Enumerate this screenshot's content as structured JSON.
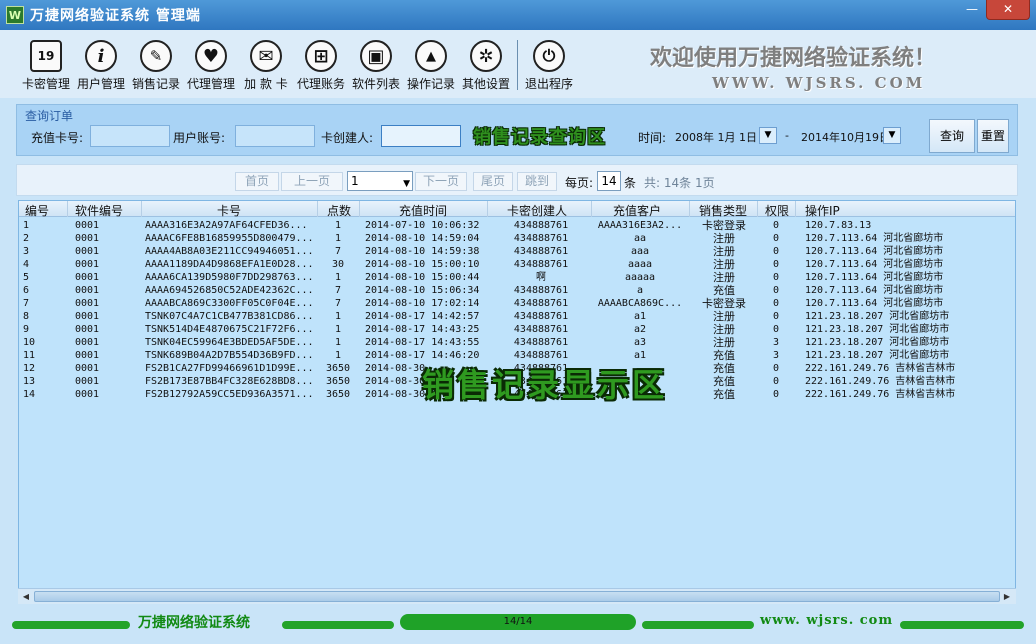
{
  "window": {
    "title": "万捷网络验证系统 管理端",
    "logo": "W",
    "minimize": "—",
    "close": "✕"
  },
  "toolbar": {
    "items": [
      {
        "label": "卡密管理",
        "icon": "calendar-icon",
        "glyph": "19"
      },
      {
        "label": "用户管理",
        "icon": "info-icon",
        "glyph": "i"
      },
      {
        "label": "销售记录",
        "icon": "pin-icon",
        "glyph": "✎"
      },
      {
        "label": "代理管理",
        "icon": "heart-icon",
        "glyph": "♥"
      },
      {
        "label": "加 款 卡",
        "icon": "mail-icon",
        "glyph": "✉"
      },
      {
        "label": "代理账务",
        "icon": "windows-icon",
        "glyph": "⊞"
      },
      {
        "label": "软件列表",
        "icon": "save-icon",
        "glyph": "▣"
      },
      {
        "label": "操作记录",
        "icon": "navigation-icon",
        "glyph": "▲"
      },
      {
        "label": "其他设置",
        "icon": "gear-icon",
        "glyph": "✲"
      },
      {
        "label": "退出程序",
        "icon": "power-icon",
        "glyph": "⏻"
      }
    ],
    "welcome": "欢迎使用万捷网络验证系统！",
    "website": "WWW. WJSRS. COM"
  },
  "query": {
    "group_title": "查询订单",
    "card_label": "充值卡号:",
    "card_value": "",
    "user_label": "用户账号:",
    "user_value": "",
    "creator_label": "卡创建人:",
    "creator_value": "",
    "time_label": "时间:",
    "date_from": "2008年  1月  1日",
    "date_sep": "-",
    "date_to": "2014年10月19日",
    "search_button": "查询",
    "reset_button": "重置",
    "overlay": "销售记录查询区"
  },
  "pager": {
    "first": "首页",
    "prev": "上一页",
    "page_select": "1",
    "next": "下一页",
    "last": "尾页",
    "jump": "跳到",
    "per_page_label": "每页:",
    "per_page_value": "14",
    "per_page_unit": "条",
    "summary": "共: 14条 1页"
  },
  "grid": {
    "columns": [
      "编号",
      "软件编号",
      "卡号",
      "点数",
      "充值时间",
      "卡密创建人",
      "充值客户",
      "销售类型",
      "权限",
      "操作IP"
    ],
    "rows": [
      [
        "1",
        "0001",
        "AAAA316E3A2A97AF64CFED36...",
        "1",
        "2014-07-10 10:06:32",
        "434888761",
        "AAAA316E3A2...",
        "卡密登录",
        "0",
        "120.7.83.13"
      ],
      [
        "2",
        "0001",
        "AAAAC6FE8B16859955D800479...",
        "1",
        "2014-08-10 14:59:04",
        "434888761",
        "aa",
        "注册",
        "0",
        "120.7.113.64  河北省廊坊市"
      ],
      [
        "3",
        "0001",
        "AAAA4AB8A03E211CC94946051...",
        "7",
        "2014-08-10 14:59:38",
        "434888761",
        "aaa",
        "注册",
        "0",
        "120.7.113.64  河北省廊坊市"
      ],
      [
        "4",
        "0001",
        "AAAA1189DA4D9868EFA1E0D28...",
        "30",
        "2014-08-10 15:00:10",
        "434888761",
        "aaaa",
        "注册",
        "0",
        "120.7.113.64  河北省廊坊市"
      ],
      [
        "5",
        "0001",
        "AAAA6CA139D5980F7DD298763...",
        "1",
        "2014-08-10 15:00:44",
        "啊",
        "aaaaa",
        "注册",
        "0",
        "120.7.113.64  河北省廊坊市"
      ],
      [
        "6",
        "0001",
        "AAAA694526850C52ADE42362C...",
        "7",
        "2014-08-10 15:06:34",
        "434888761",
        "a",
        "充值",
        "0",
        "120.7.113.64  河北省廊坊市"
      ],
      [
        "7",
        "0001",
        "AAAABCA869C3300FF05C0F04E...",
        "7",
        "2014-08-10 17:02:14",
        "434888761",
        "AAAABCA869C...",
        "卡密登录",
        "0",
        "120.7.113.64  河北省廊坊市"
      ],
      [
        "8",
        "0001",
        "TSNK07C4A7C1CB477B381CD86...",
        "1",
        "2014-08-17 14:42:57",
        "434888761",
        "a1",
        "注册",
        "0",
        "121.23.18.207  河北省廊坊市"
      ],
      [
        "9",
        "0001",
        "TSNK514D4E4870675C21F72F6...",
        "1",
        "2014-08-17 14:43:25",
        "434888761",
        "a2",
        "注册",
        "0",
        "121.23.18.207  河北省廊坊市"
      ],
      [
        "10",
        "0001",
        "TSNK04EC59964E3BDED5AF5DE...",
        "1",
        "2014-08-17 14:43:55",
        "434888761",
        "a3",
        "注册",
        "3",
        "121.23.18.207  河北省廊坊市"
      ],
      [
        "11",
        "0001",
        "TSNK689B04A2D7B554D36B9FD...",
        "1",
        "2014-08-17 14:46:20",
        "434888761",
        "a1",
        "充值",
        "3",
        "121.23.18.207  河北省廊坊市"
      ],
      [
        "12",
        "0001",
        "FS2B1CA27FD99466961D1D99E...",
        "3650",
        "2014-08-30 ...",
        "434888761",
        "",
        "充值",
        "0",
        "222.161.249.76  吉林省吉林市"
      ],
      [
        "13",
        "0001",
        "FS2B173E87BB4FC328E628BD8...",
        "3650",
        "2014-08-30 ...",
        "434888761",
        "",
        "充值",
        "0",
        "222.161.249.76  吉林省吉林市"
      ],
      [
        "14",
        "0001",
        "FS2B12792A59CC5ED936A3571...",
        "3650",
        "2014-08-30 ...",
        "434888761",
        "",
        "充值",
        "0",
        "222.161.249.76  吉林省吉林市"
      ]
    ],
    "overlay": "销售记录显示区"
  },
  "status": {
    "app_name": "万捷网络验证系统",
    "progress": "14/14",
    "website": "www. wjsrs. com"
  },
  "colors": {
    "accent_green": "#22a329",
    "title_blue": "#2f77c0",
    "close_red": "#c7473a"
  }
}
